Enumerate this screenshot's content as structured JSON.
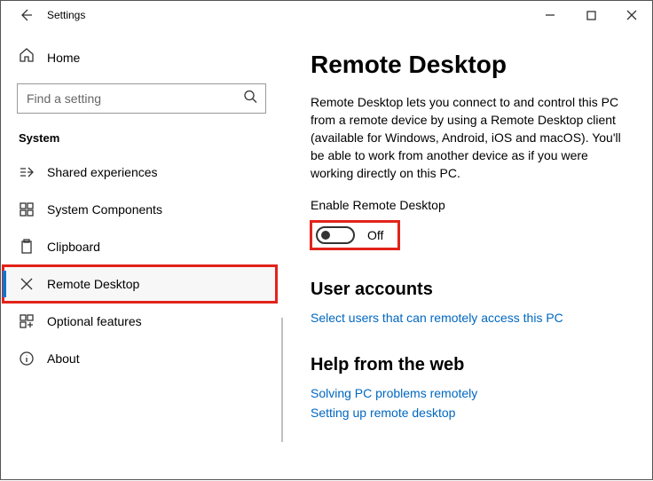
{
  "titlebar": {
    "title": "Settings"
  },
  "sidebar": {
    "home_label": "Home",
    "search_placeholder": "Find a setting",
    "category_title": "System",
    "items": [
      {
        "label": "Shared experiences"
      },
      {
        "label": "System Components"
      },
      {
        "label": "Clipboard"
      },
      {
        "label": "Remote Desktop"
      },
      {
        "label": "Optional features"
      },
      {
        "label": "About"
      }
    ]
  },
  "main": {
    "page_title": "Remote Desktop",
    "description": "Remote Desktop lets you connect to and control this PC from a remote device by using a Remote Desktop client (available for Windows, Android, iOS and macOS). You'll be able to work from another device as if you were working directly on this PC.",
    "enable_label": "Enable Remote Desktop",
    "toggle_state": "Off",
    "user_accounts_title": "User accounts",
    "select_users_link": "Select users that can remotely access this PC",
    "help_title": "Help from the web",
    "help_links": [
      "Solving PC problems remotely",
      "Setting up remote desktop"
    ]
  }
}
